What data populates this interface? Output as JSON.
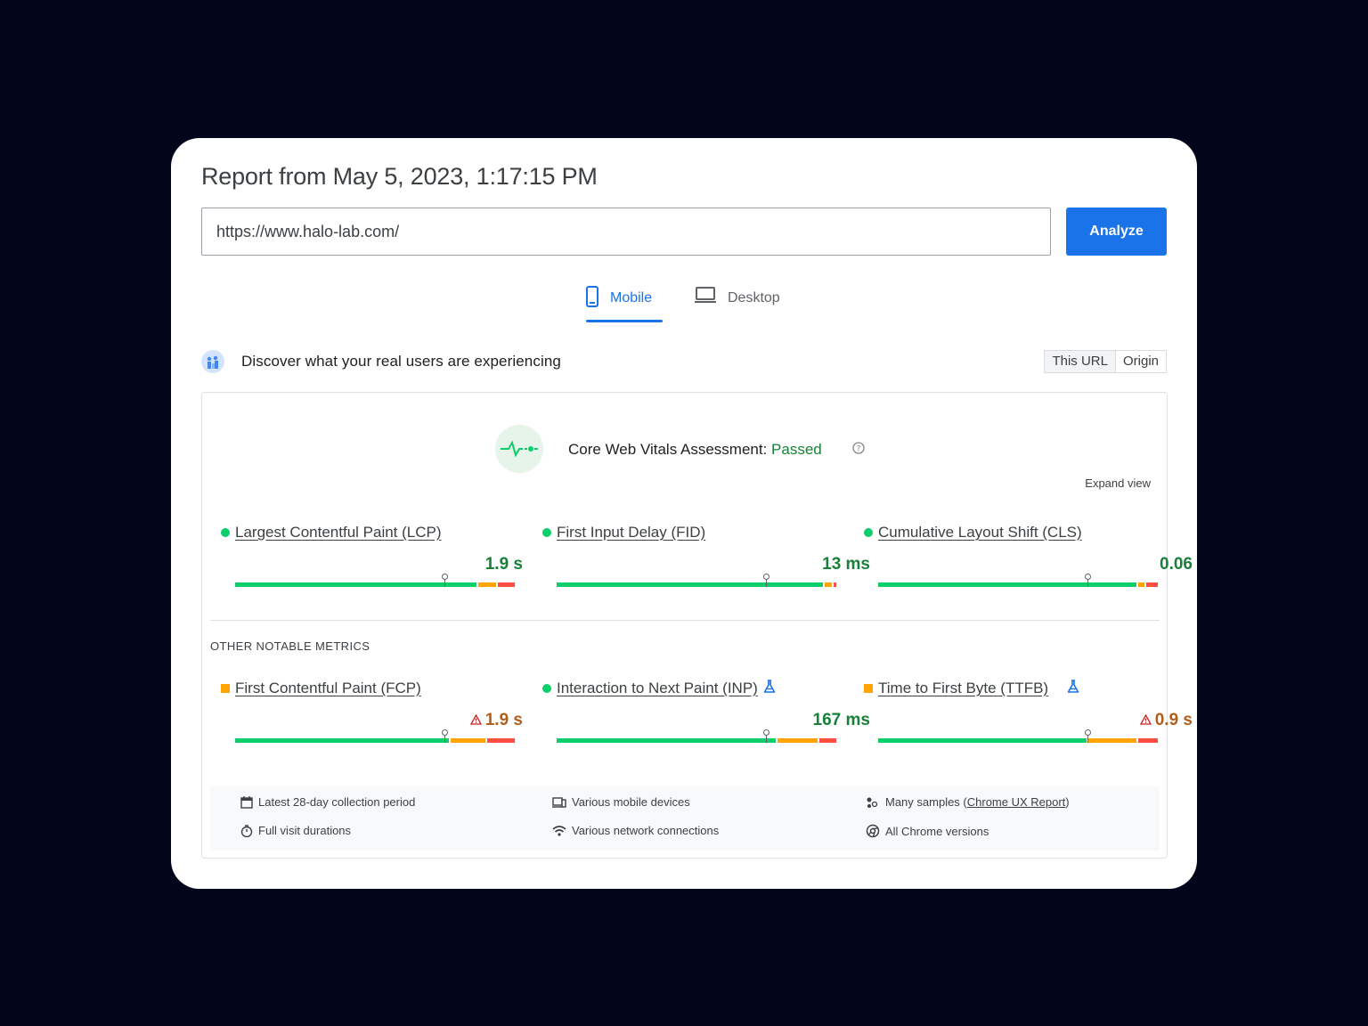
{
  "report": {
    "title": "Report from May 5, 2023, 1:17:15 PM"
  },
  "search": {
    "url_value": "https://www.halo-lab.com/",
    "analyze_label": "Analyze"
  },
  "tabs": {
    "mobile": "Mobile",
    "desktop": "Desktop",
    "active": "Mobile"
  },
  "crux": {
    "heading": "Discover what your real users are experiencing",
    "toggle": {
      "this_url": "This URL",
      "origin": "Origin",
      "active": "This URL"
    }
  },
  "assessment": {
    "label": "Core Web Vitals Assessment:",
    "status": "Passed",
    "expand_label": "Expand view"
  },
  "core_metrics": [
    {
      "name": "Largest Contentful Paint (LCP)",
      "value": "1.9 s",
      "rating": "good",
      "marker": 0.75,
      "segments": [
        0.87,
        0.07,
        0.06
      ]
    },
    {
      "name": "First Input Delay (FID)",
      "value": "13 ms",
      "rating": "good",
      "marker": 0.75,
      "segments": [
        0.96,
        0.03,
        0.01
      ]
    },
    {
      "name": "Cumulative Layout Shift (CLS)",
      "value": "0.06",
      "rating": "good",
      "marker": 0.75,
      "segments": [
        0.93,
        0.03,
        0.04
      ]
    }
  ],
  "other": {
    "heading": "OTHER NOTABLE METRICS",
    "metrics": [
      {
        "name": "First Contentful Paint (FCP)",
        "value": "1.9 s",
        "rating": "average",
        "experimental": false,
        "marker": 0.75,
        "segments": [
          0.77,
          0.13,
          0.1
        ]
      },
      {
        "name": "Interaction to Next Paint (INP)",
        "value": "167 ms",
        "rating": "good",
        "experimental": true,
        "marker": 0.75,
        "segments": [
          0.79,
          0.15,
          0.06
        ]
      },
      {
        "name": "Time to First Byte (TTFB)",
        "value": "0.9 s",
        "rating": "average",
        "experimental": true,
        "marker": 0.75,
        "segments": [
          0.75,
          0.18,
          0.07
        ]
      }
    ]
  },
  "footer": {
    "period": "Latest 28-day collection period",
    "devices": "Various mobile devices",
    "samples_prefix": "Many samples (",
    "samples_link": "Chrome UX Report",
    "samples_suffix": ")",
    "durations": "Full visit durations",
    "network": "Various network connections",
    "chrome": "All Chrome versions"
  },
  "colors": {
    "good": "#0cce6b",
    "average": "#ffa400",
    "poor": "#ff4e42",
    "accent": "#1a73e8"
  },
  "icons": [
    "mobile-phone-icon",
    "laptop-icon",
    "crux-users-icon",
    "pulse-icon",
    "help-icon",
    "flask-icon",
    "warning-triangle-icon",
    "calendar-icon",
    "devices-icon",
    "samples-icon",
    "timer-icon",
    "wifi-icon",
    "chrome-icon"
  ]
}
